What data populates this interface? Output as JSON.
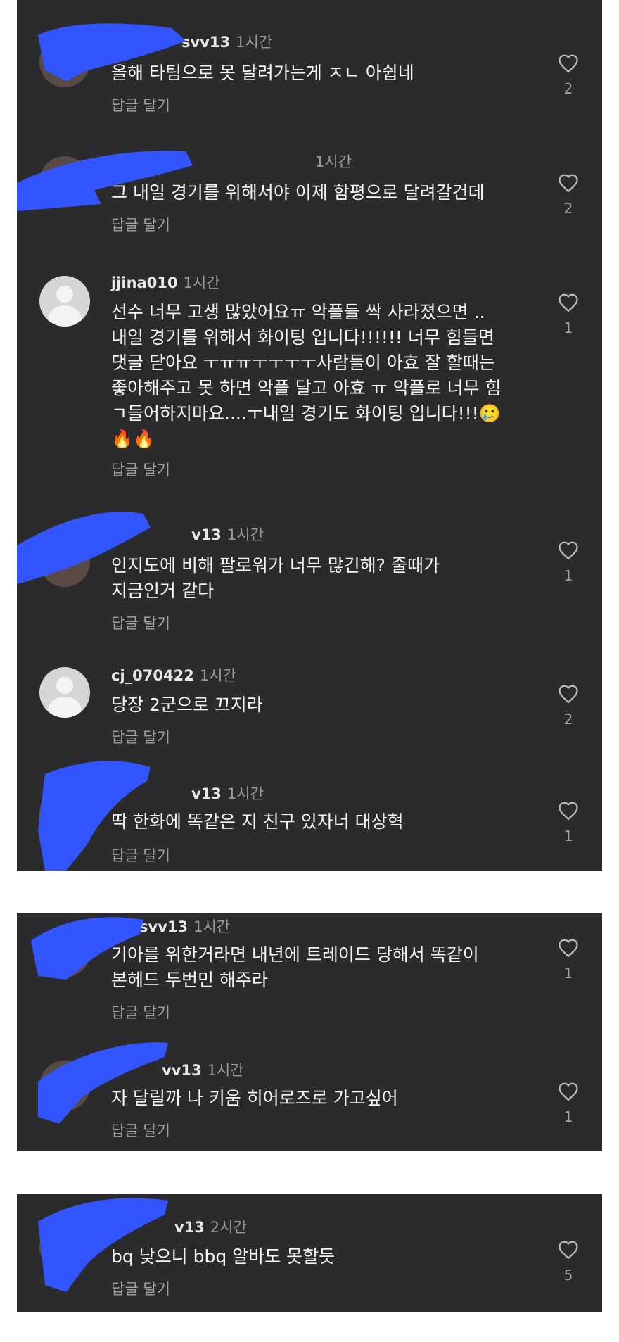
{
  "colors": {
    "panel": "#2b2b2d",
    "redaction": "#3355ff",
    "muted": "#9a9a9a",
    "text": "#f5f5f5"
  },
  "reply_label": "답글 달기",
  "comments": [
    {
      "username": "svv13",
      "time": "1시간",
      "text": "올해 타팀으로 못 달려가는게 ㅈㄴ 아쉽네",
      "likes": "2"
    },
    {
      "username": "",
      "time": "1시간",
      "text": "그 내일 경기를 위해서야 이제 함평으로 달려갈건데",
      "likes": "2"
    },
    {
      "username": "jjina010",
      "time": "1시간",
      "text": "선수 너무 고생 많았어요ㅠ 악플들 싹 사라졌으면 ..\n내일 경기를 위해서 화이팅 입니다!!!!!! 너무 힘들면\n댓글 닫아요 ㅜㅠㅠㅜㅜㅜㅜ사람들이 아효 잘 할때는\n좋아해주고 못 하면 악플 달고 아효 ㅠ 악플로 너무 힘\nㄱ들어하지마요....ㅜ내일 경기도 화이팅 입니다!!!🥲\n🔥🔥",
      "likes": "1"
    },
    {
      "username": "v13",
      "time": "1시간",
      "text": "인지도에 비해 팔로워가 너무 많긴해? 줄때가\n지금인거 같다",
      "likes": "1"
    },
    {
      "username": "cj_070422",
      "time": "1시간",
      "text": "당장 2군으로 끄지라",
      "likes": "2"
    },
    {
      "username": "v13",
      "time": "1시간",
      "text": "딱 한화에 똑같은 지 친구 있자너 대상혁",
      "likes": "1"
    },
    {
      "username": "svv13",
      "time": "1시간",
      "text": "기아를 위한거라면 내년에 트레이드 당해서 똑같이\n본헤드 두번민 해주라",
      "likes": "1"
    },
    {
      "username": "vv13",
      "time": "1시간",
      "text": "자 달릴까 나 키움 히어로즈로 가고싶어",
      "likes": "1"
    },
    {
      "username": "v13",
      "time": "2시간",
      "text": "bq 낮으니 bbq 알바도 못할듯",
      "likes": "5"
    }
  ]
}
